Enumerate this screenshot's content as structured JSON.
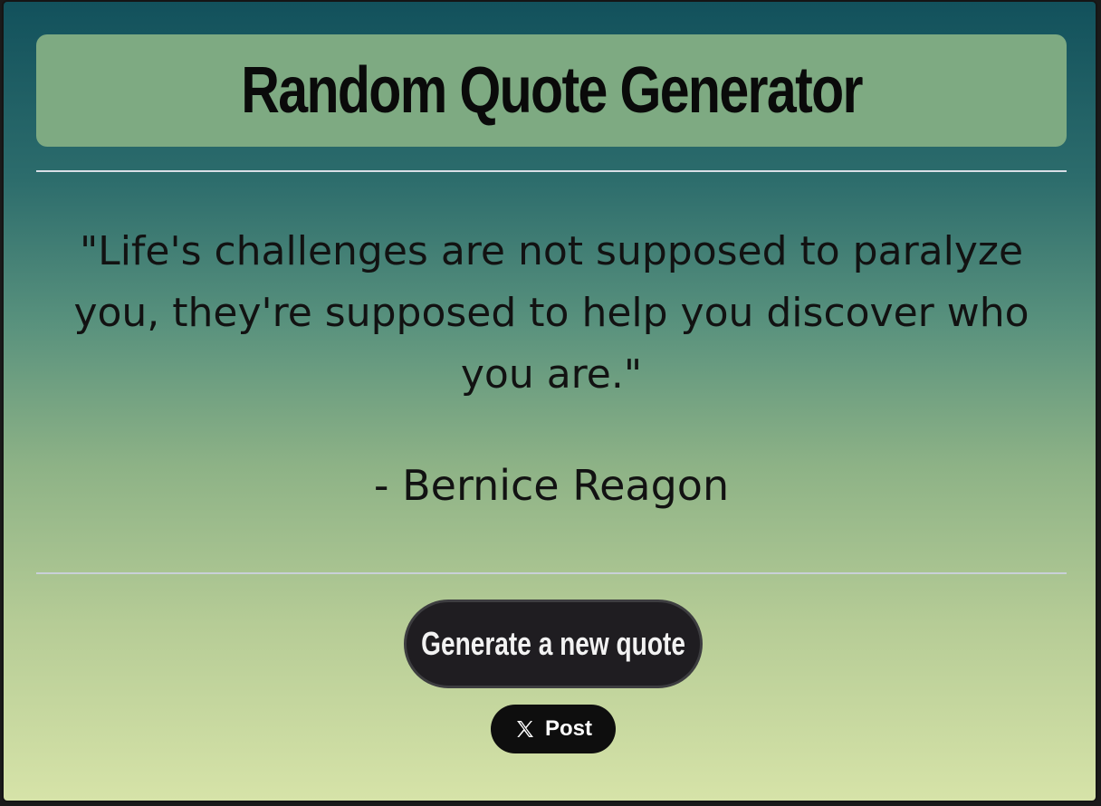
{
  "header": {
    "title": "Random Quote Generator"
  },
  "quote": {
    "text": "\"Life's challenges are not supposed to paralyze you, they're supposed to help you discover who you are.\"",
    "author": "- Bernice Reagon"
  },
  "actions": {
    "generate_label": "Generate a new quote",
    "post_label": "Post",
    "post_icon": "x-logo-icon"
  },
  "colors": {
    "gradient_top": "#12515c",
    "gradient_bottom": "#d6e3a8",
    "header_bg": "#7eaa82",
    "button_bg": "#1f1d21"
  }
}
